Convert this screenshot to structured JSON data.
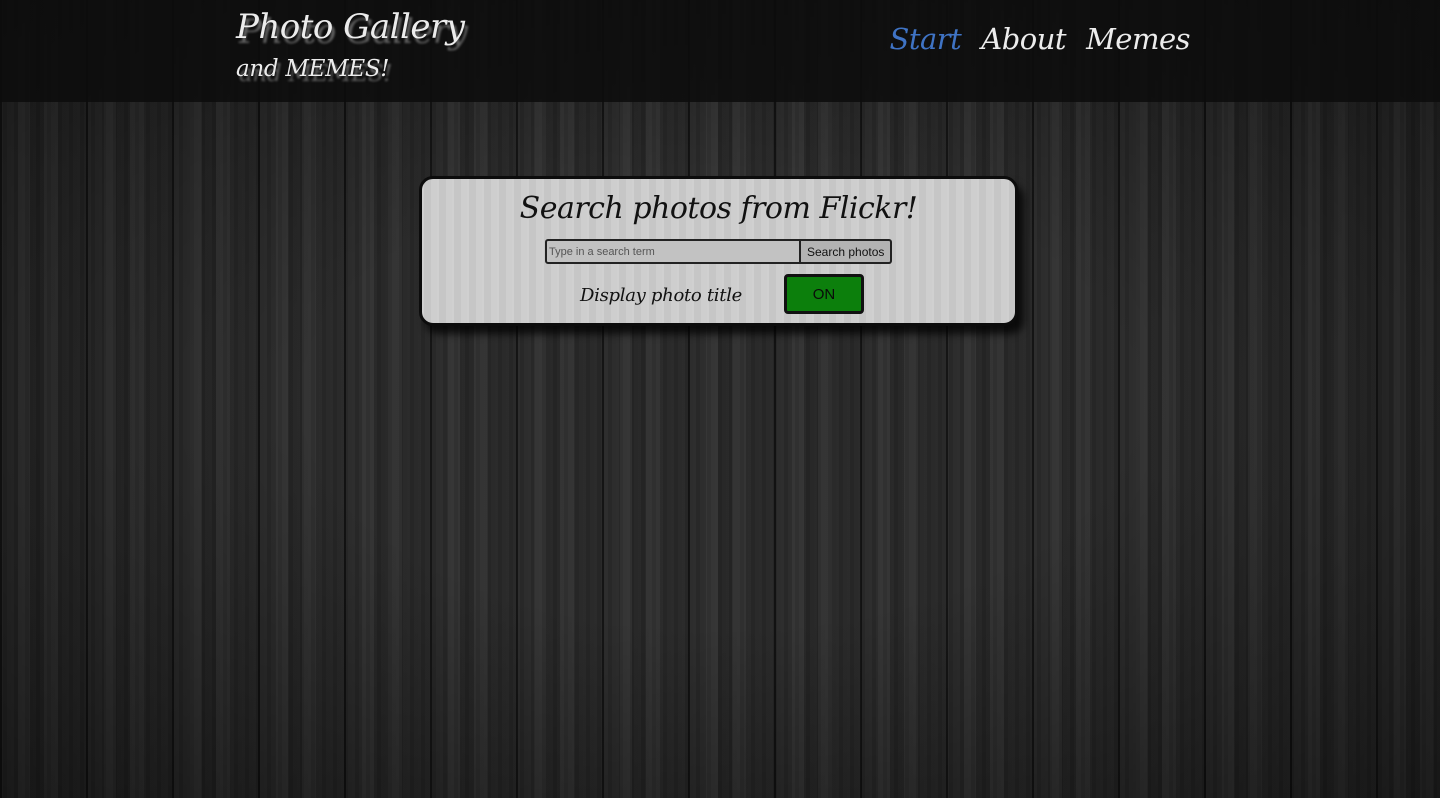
{
  "header": {
    "title_line1": "Photo Gallery",
    "title_line2": "and MEMES!",
    "nav": [
      {
        "label": "Start",
        "active": true
      },
      {
        "label": "About",
        "active": false
      },
      {
        "label": "Memes",
        "active": false
      }
    ]
  },
  "search_panel": {
    "heading": "Search photos from Flickr!",
    "search_placeholder": "Type in a search term",
    "search_value": "",
    "search_button_label": "Search photos",
    "toggle_label": "Display photo title",
    "toggle_state": "ON"
  },
  "colors": {
    "nav_active": "#3f73c4",
    "nav_inactive": "#ececec",
    "toggle_on": "#0c7f0c",
    "panel_bg": "#cbcbcb",
    "header_bg": "#0c0c0c"
  }
}
